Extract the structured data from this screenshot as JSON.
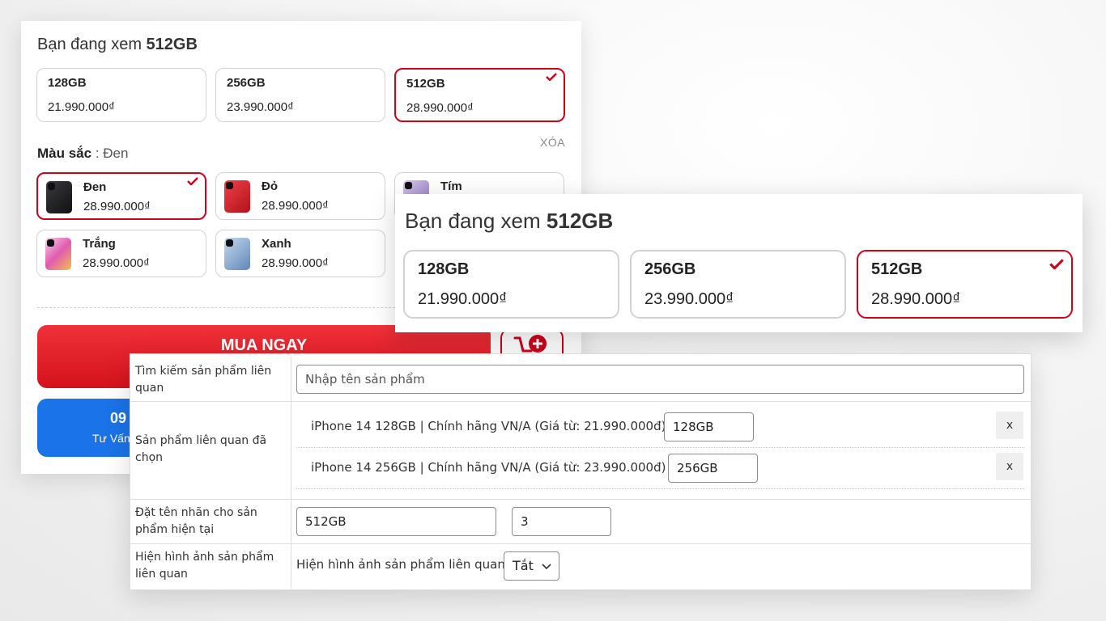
{
  "panel1": {
    "viewing_prefix": "Bạn đang xem",
    "viewing_value": "512GB",
    "storage_options": [
      {
        "name": "128GB",
        "price": "21.990.000₫",
        "selected": false
      },
      {
        "name": "256GB",
        "price": "23.990.000₫",
        "selected": false
      },
      {
        "name": "512GB",
        "price": "28.990.000₫",
        "selected": true
      }
    ],
    "clear_label": "XÓA",
    "color_label": "Màu sắc",
    "color_value": "Đen",
    "colors": [
      {
        "name": "Đen",
        "price": "28.990.000₫",
        "selected": true,
        "swatch": "#2b2b30"
      },
      {
        "name": "Đỏ",
        "price": "28.990.000₫",
        "selected": false,
        "swatch": "#d8232a"
      },
      {
        "name": "Tím",
        "price": "",
        "selected": false,
        "swatch": "#b9a3d6"
      },
      {
        "name": "Trắng",
        "price": "28.990.000₫",
        "selected": false,
        "swatch": "#f2efe9"
      },
      {
        "name": "Xanh",
        "price": "28.990.000₫",
        "selected": false,
        "swatch": "#a7c0dc"
      }
    ],
    "buy_label": "MUA NGAY",
    "call_number": "09",
    "call_text": "Tư Vấn",
    "accent": "#d0021b",
    "call_color": "#1a73e8"
  },
  "panel2": {
    "viewing_prefix": "Bạn đang xem",
    "viewing_value": "512GB",
    "storage_options": [
      {
        "name": "128GB",
        "price": "21.990.000₫",
        "selected": false
      },
      {
        "name": "256GB",
        "price": "23.990.000₫",
        "selected": false
      },
      {
        "name": "512GB",
        "price": "28.990.000₫",
        "selected": true
      }
    ]
  },
  "admin": {
    "search_label": "Tìm kiếm sản phẩm liên quan",
    "search_placeholder": "Nhập tên sản phẩm",
    "selected_label": "Sản phẩm liên quan đã chọn",
    "related": [
      {
        "title": "iPhone 14 128GB | Chính hãng VN/A (Giá từ: 21.990.000đ)",
        "tag": "128GB",
        "remove": "x"
      },
      {
        "title": "iPhone 14 256GB | Chính hãng VN/A (Giá từ: 23.990.000đ)",
        "tag": "256GB",
        "remove": "x"
      }
    ],
    "current_label": "Đặt tên nhãn cho sản phẩm hiện tại",
    "current_tag": "512GB",
    "current_order": "3",
    "show_image_label": "Hiện hình ảnh sản phẩm liên quan",
    "show_image_inline": "Hiện hình ảnh sản phẩm liên quan",
    "show_image_value": "Tắt"
  }
}
